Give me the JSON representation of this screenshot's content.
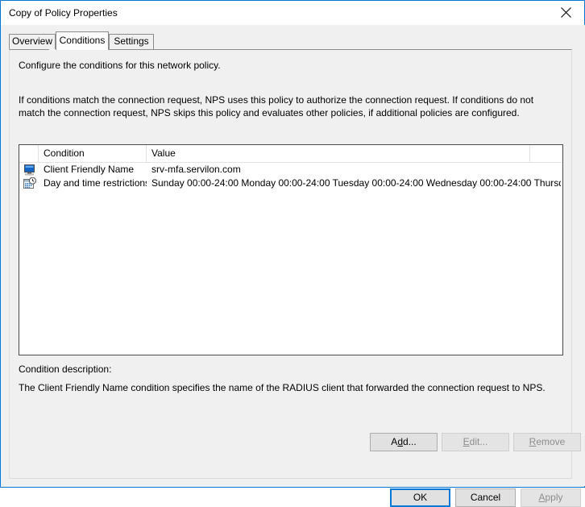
{
  "window": {
    "title": "Copy of Policy Properties",
    "close_icon": "close-icon"
  },
  "tabs": [
    {
      "id": "overview",
      "label": "Overview",
      "active": false
    },
    {
      "id": "conditions",
      "label": "Conditions",
      "active": true
    },
    {
      "id": "settings",
      "label": "Settings",
      "active": false
    }
  ],
  "panel": {
    "lead": "Configure the conditions for this network policy.",
    "paragraph": "If conditions match the connection request, NPS uses this policy to authorize the connection request. If conditions do not match the connection request, NPS skips this policy and evaluates other policies, if additional policies are configured."
  },
  "listview": {
    "columns": [
      "",
      "Condition",
      "Value",
      ""
    ],
    "rows": [
      {
        "icon": "computer-monitor-icon",
        "condition": "Client Friendly Name",
        "value": "srv-mfa.servilon.com"
      },
      {
        "icon": "calendar-clock-icon",
        "condition": "Day and time restrictions",
        "value": "Sunday 00:00-24:00 Monday 00:00-24:00 Tuesday 00:00-24:00 Wednesday 00:00-24:00 Thursd..."
      }
    ]
  },
  "description": {
    "label": "Condition description:",
    "text": "The Client Friendly Name condition specifies the name of the RADIUS client that forwarded the connection request to NPS."
  },
  "actions": {
    "add": {
      "label": "Add...",
      "accel": "d",
      "enabled": true
    },
    "edit": {
      "label": "Edit...",
      "accel": "E",
      "enabled": false
    },
    "remove": {
      "label": "Remove",
      "accel": "R",
      "enabled": false
    }
  },
  "footer": {
    "ok": {
      "label": "OK",
      "enabled": true,
      "default": true
    },
    "cancel": {
      "label": "Cancel",
      "enabled": true,
      "default": false
    },
    "apply": {
      "label": "Apply",
      "accel": "A",
      "enabled": false,
      "default": false
    }
  },
  "colors": {
    "accent": "#0078d7",
    "window_bg": "#f0f0f0",
    "field_bg": "#ffffff",
    "border": "#4a4a4a",
    "disabled_text": "#8d8d8d"
  }
}
